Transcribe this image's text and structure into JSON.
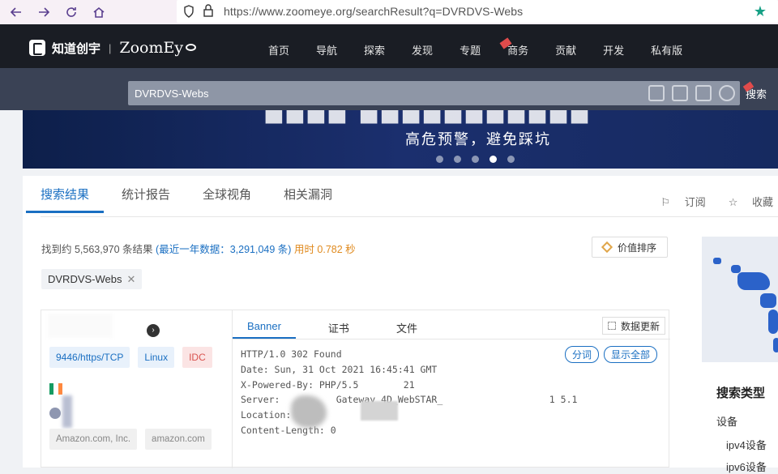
{
  "browser": {
    "url": "https://www.zoomeye.org/searchResult?q=DVRDVS-Webs"
  },
  "header": {
    "logo_cn": "知道创宇",
    "logo_sep": "|",
    "logo_en": "ZoomEy",
    "menu": [
      "首页",
      "导航",
      "探索",
      "发现",
      "专题",
      "商务",
      "贡献",
      "开发",
      "私有版"
    ]
  },
  "search": {
    "query": "DVRDVS-Webs",
    "side_label": "搜索"
  },
  "promo": {
    "subtitle": "高危预警，避免踩坑"
  },
  "tabs": [
    "搜索结果",
    "统计报告",
    "全球视角",
    "相关漏洞"
  ],
  "actions": {
    "subscribe": "订阅",
    "collect": "收藏"
  },
  "stats": {
    "found_prefix": "找到约 5,563,970 条结果",
    "recent": "(最近一年数据：3,291,049 条)",
    "time": "用时 0.782 秒"
  },
  "sort_button": "价值排序",
  "filter_chip": "DVRDVS-Webs",
  "result": {
    "port_tag": "9446/https/TCP",
    "os_tag": "Linux",
    "type_tag": "IDC",
    "org_tags": [
      "Amazon.com, Inc.",
      "amazon.com"
    ],
    "detail_tabs": [
      "Banner",
      "证书",
      "文件"
    ],
    "update_button": "数据更新",
    "banner_lines": [
      "HTTP/1.0 302 Found",
      "Date: Sun, 31 Oct 2021 16:45:41 GMT",
      "X-Powered-By: PHP/5.5        21",
      "Server:          Gateway 4D_WebSTAR_                   1 5.1",
      "Location:",
      "Content-Length: 0"
    ],
    "btn_wrap": "分词",
    "btn_show_all": "显示全部"
  },
  "sidebar": {
    "search_type": "搜索类型",
    "device": "设备",
    "ipv4": "ipv4设备",
    "ipv6": "ipv6设备"
  }
}
